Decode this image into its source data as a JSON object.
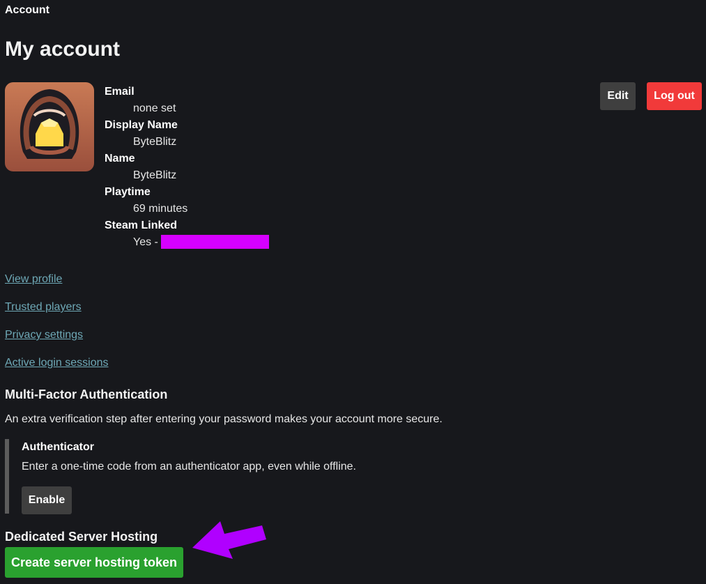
{
  "breadcrumb": "Account",
  "page_title": "My account",
  "profile": {
    "fields": [
      {
        "label": "Email",
        "value": "none set"
      },
      {
        "label": "Display Name",
        "value": "ByteBlitz"
      },
      {
        "label": "Name",
        "value": "ByteBlitz"
      },
      {
        "label": "Playtime",
        "value": "69 minutes"
      },
      {
        "label": "Steam Linked",
        "value": "Yes -"
      }
    ]
  },
  "actions": {
    "edit_label": "Edit",
    "logout_label": "Log out"
  },
  "links": [
    "View profile",
    "Trusted players",
    "Privacy settings",
    "Active login sessions"
  ],
  "mfa": {
    "heading": "Multi-Factor Authentication",
    "description": "An extra verification step after entering your password makes your account more secure.",
    "authenticator": {
      "title": "Authenticator",
      "description": "Enter a one-time code from an authenticator app, even while offline.",
      "button_label": "Enable"
    }
  },
  "server_hosting": {
    "heading": "Dedicated Server Hosting",
    "button_label": "Create server hosting token"
  },
  "colors": {
    "background": "#17181c",
    "link": "#6ea8b6",
    "logout": "#f13a3a",
    "token_button": "#2aa12f",
    "annotation_arrow": "#b000ff",
    "redaction": "#d600ff"
  }
}
